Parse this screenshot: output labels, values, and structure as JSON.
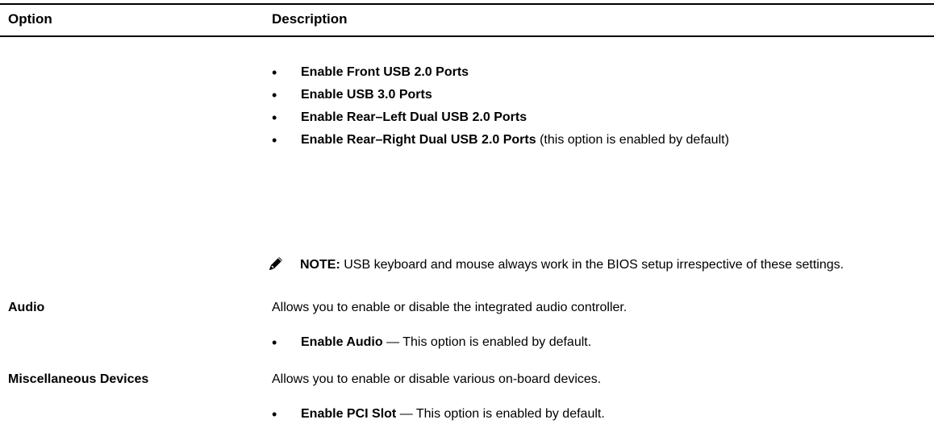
{
  "table": {
    "header": {
      "option": "Option",
      "description": "Description"
    }
  },
  "usb": {
    "items": [
      {
        "bold": "Enable Front USB 2.0 Ports",
        "rest": ""
      },
      {
        "bold": "Enable USB 3.0 Ports",
        "rest": ""
      },
      {
        "bold": "Enable Rear–Left Dual USB 2.0 Ports",
        "rest": ""
      },
      {
        "bold": "Enable Rear–Right Dual USB 2.0 Ports",
        "rest": " (this option is enabled by default)"
      }
    ],
    "note": {
      "label": "NOTE:",
      "text": " USB keyboard and mouse always work in the BIOS setup irrespective of these settings.",
      "icon": "pencil-note-icon"
    }
  },
  "audio": {
    "option": "Audio",
    "description": "Allows you to enable or disable the integrated audio controller.",
    "items": [
      {
        "bold": "Enable Audio",
        "rest": " — This option is enabled by default."
      }
    ]
  },
  "misc": {
    "option": "Miscellaneous Devices",
    "description": "Allows you to enable or disable various on-board devices.",
    "items": [
      {
        "bold": "Enable PCI Slot",
        "rest": " — This option is enabled by default."
      }
    ]
  },
  "bullet_char": "•"
}
